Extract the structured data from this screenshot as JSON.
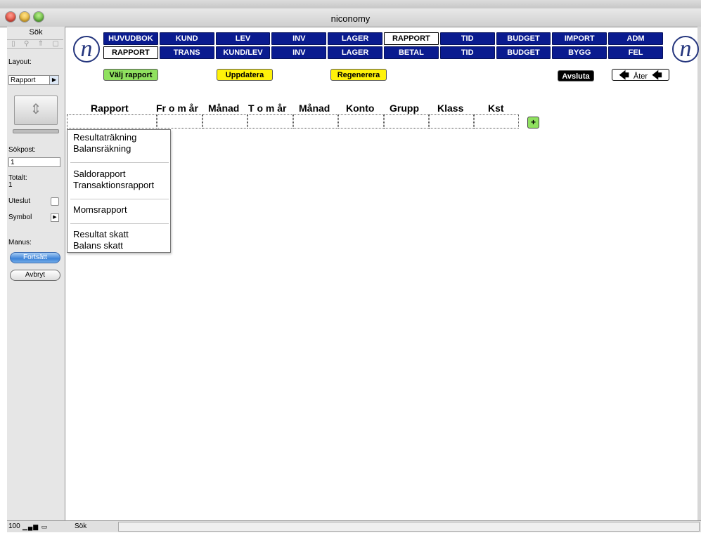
{
  "window": {
    "title": "niconomy"
  },
  "status_area": {
    "mode_label": "Sök",
    "layout_label": "Layout:",
    "layout_value": "Rapport",
    "record_label": "Sökpost:",
    "record_value": "1",
    "total_label": "Totalt:",
    "total_value": "1",
    "omit_label": "Uteslut",
    "symbol_label": "Symbol",
    "script_label": "Manus:",
    "continue_button": "Fortsätt",
    "cancel_button": "Avbryt"
  },
  "bottom_bar": {
    "zoom": "100",
    "mode": "Sök"
  },
  "nav": {
    "row1": [
      "HUVUDBOK",
      "KUND",
      "LEV",
      "INV",
      "LAGER",
      "RAPPORT",
      "TID",
      "BUDGET",
      "IMPORT",
      "ADM"
    ],
    "row1_active": 5,
    "row2": [
      "RAPPORT",
      "TRANS",
      "KUND/LEV",
      "INV",
      "LAGER",
      "BETAL",
      "TID",
      "BUDGET",
      "BYGG",
      "FEL"
    ],
    "row2_active": 0
  },
  "actions": {
    "choose_report": "Välj rapport",
    "update": "Uppdatera",
    "regenerate": "Regenerera",
    "quit": "Avsluta",
    "back": "Åter"
  },
  "form": {
    "columns": [
      "Rapport",
      "Fr o m år",
      "Månad",
      "T o m år",
      "Månad",
      "Konto",
      "Grupp",
      "Klass",
      "Kst"
    ],
    "add_symbol": "+"
  },
  "report_menu": {
    "groups": [
      [
        "Resultaträkning",
        "Balansräkning"
      ],
      [
        "Saldorapport",
        "Transaktionsrapport"
      ],
      [
        "Momsrapport"
      ],
      [
        "Resultat skatt",
        "Balans skatt"
      ]
    ]
  },
  "icons": {
    "logo": "niconomy-n-logo",
    "arrow_left": "arrow-left-icon"
  },
  "colors": {
    "tab_blue": "#0a1b8f",
    "button_green": "#8fe15f",
    "button_yellow": "#fff20a"
  }
}
